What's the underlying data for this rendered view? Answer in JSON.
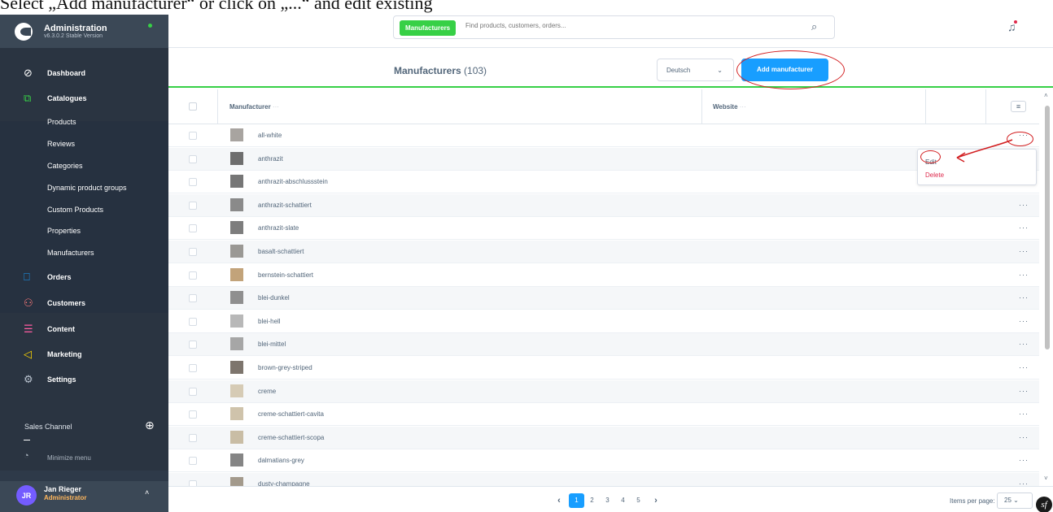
{
  "caption": "Select „Add manufacturer“ or click on „...“ and edit existing",
  "brand": {
    "title": "Administration",
    "version": "v6.3.0.2 Stable Version"
  },
  "nav": {
    "dashboard": "Dashboard",
    "catalogues": "Catalogues",
    "catalogue_items": [
      "Products",
      "Reviews",
      "Categories",
      "Dynamic product groups",
      "Custom Products",
      "Properties",
      "Manufacturers"
    ],
    "orders": "Orders",
    "customers": "Customers",
    "content": "Content",
    "marketing": "Marketing",
    "settings": "Settings",
    "sales_channel": "Sales Channel",
    "minimize": "Minimize menu"
  },
  "user": {
    "initials": "JR",
    "name": "Jan Rieger",
    "role": "Administrator"
  },
  "search": {
    "tag": "Manufacturers",
    "placeholder": "Find products, customers, orders..."
  },
  "toolbar": {
    "title": "Manufacturers",
    "count": "(103)",
    "language": "Deutsch",
    "add_label": "Add manufacturer"
  },
  "grid": {
    "columns": {
      "manufacturer": "Manufacturer",
      "website": "Website",
      "dots": "···"
    },
    "rows": [
      {
        "name": "all-white",
        "swatch": "#a8a4a0"
      },
      {
        "name": "anthrazit",
        "swatch": "#6e6e6e"
      },
      {
        "name": "anthrazit-abschlussstein",
        "swatch": "#767676"
      },
      {
        "name": "anthrazit-schattiert",
        "swatch": "#8a8a8a"
      },
      {
        "name": "anthrazit-slate",
        "swatch": "#7d7d7d"
      },
      {
        "name": "basalt-schattiert",
        "swatch": "#9a9894"
      },
      {
        "name": "bernstein-schattiert",
        "swatch": "#c2a37a"
      },
      {
        "name": "blei-dunkel",
        "swatch": "#8f8f8f"
      },
      {
        "name": "blei-hell",
        "swatch": "#b8b8b8"
      },
      {
        "name": "blei-mittel",
        "swatch": "#a6a6a6"
      },
      {
        "name": "brown-grey-striped",
        "swatch": "#7d756d"
      },
      {
        "name": "creme",
        "swatch": "#d6cbb5"
      },
      {
        "name": "creme-schattiert-cavita",
        "swatch": "#cfc3ab"
      },
      {
        "name": "creme-schattiert-scopa",
        "swatch": "#c9bda5"
      },
      {
        "name": "dalmatians-grey",
        "swatch": "#858585"
      },
      {
        "name": "dusty-champagne",
        "swatch": "#a39a8c"
      }
    ],
    "row_action": "···"
  },
  "context_menu": {
    "edit": "Edit",
    "delete": "Delete"
  },
  "pagination": {
    "pages": [
      "1",
      "2",
      "3",
      "4",
      "5"
    ],
    "items_label": "Items per page:",
    "items_value": "25"
  },
  "colors": {
    "sidebar": "#2e3a49",
    "accent_green": "#37d046",
    "primary_blue": "#189eff",
    "annotation_red": "#d21f21",
    "danger": "#de294c"
  }
}
